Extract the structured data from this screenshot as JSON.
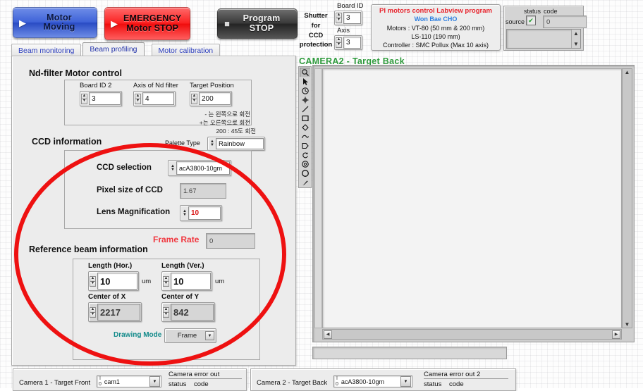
{
  "toolbar": {
    "motor_moving": "Motor Moving",
    "emergency_l1": "EMERGENCY",
    "emergency_l2": "Motor STOP",
    "program_stop": "Program STOP"
  },
  "tabs": [
    {
      "label": "Beam monitoring",
      "selected": false
    },
    {
      "label": "Beam profiling",
      "selected": true
    },
    {
      "label": "Motor calibration",
      "selected": false
    }
  ],
  "shutter": {
    "title_l1": "Shutter for",
    "title_l2": "CCD",
    "title_l3": "protection",
    "board_id_label": "Board ID",
    "board_id_value": "3",
    "axis_label": "Axis",
    "axis_value": "3"
  },
  "program_info": {
    "line1": "PI motors control Labview program",
    "line2": "Won Bae CHO",
    "line3": "Motors : VT-80 (50 mm & 200 mm)",
    "line4": "LS-110 (190 mm)",
    "line5": "Controller : SMC Pollux (Max 10 axis)"
  },
  "error_cluster_top": {
    "status_label": "status",
    "code_label": "code",
    "source_label": "source",
    "code_value": "0",
    "status_glyph": "check"
  },
  "nd_filter": {
    "section_title": "Nd-filter Motor control",
    "board_id_label": "Board ID 2",
    "board_id_value": "3",
    "axis_label": "Axis of Nd filter",
    "axis_value": "4",
    "target_label": "Target Position",
    "target_value": "200",
    "note1": "- 는 왼쪽으로 회전",
    "note2": "+는 오른쪽으로 회전",
    "note3": "200 : 45도 회전"
  },
  "ccd_info": {
    "section_title": "CCD information",
    "palette_label": "Palette Type",
    "palette_value": "Rainbow",
    "ccd_selection_label": "CCD selection",
    "ccd_selection_value": "acA3800-10gm",
    "pixel_size_label": "Pixel size of CCD",
    "pixel_size_value": "1.67",
    "lens_mag_label": "Lens Magnification",
    "lens_mag_value": "10",
    "frame_rate_label": "Frame Rate",
    "frame_rate_value": "0"
  },
  "ref_beam": {
    "section_title": "Reference beam information",
    "len_hor_label": "Length (Hor.)",
    "len_hor_value": "10",
    "len_hor_unit": "um",
    "len_ver_label": "Length (Ver.)",
    "len_ver_value": "10",
    "len_ver_unit": "um",
    "center_x_label": "Center of X",
    "center_x_value": "2217",
    "center_y_label": "Center of Y",
    "center_y_value": "842",
    "drawing_mode_label": "Drawing Mode",
    "drawing_mode_value": "Frame"
  },
  "camera_panel": {
    "title": "CAMERA2 - Target Back",
    "tools": [
      "zoom-icon",
      "cursor-icon",
      "pan-icon",
      "crosshair-icon",
      "line-icon",
      "rectangle-icon",
      "oval-icon",
      "freehand-icon",
      "polygon-icon",
      "rotate-icon",
      "annulus-icon",
      "circle-icon",
      "brush-icon"
    ]
  },
  "bottom": {
    "cam1_label": "Camera 1 - Target Front",
    "cam1_value": "cam1",
    "cam1_error_title": "Camera error out",
    "cam1_status_label": "status",
    "cam1_code_label": "code",
    "cam2_label": "Camera 2 - Target Back",
    "cam2_value": "acA3800-10gm",
    "cam2_error_title": "Camera error out 2",
    "cam2_status_label": "status",
    "cam2_code_label": "code"
  },
  "annotation": {
    "shape": "red-ellipse-highlight",
    "color": "#ee1111"
  },
  "colors": {
    "panel_bg": "#ececec",
    "accent_red": "#e8242d",
    "accent_blue": "#2d7fe0",
    "camera_title_green": "#2f9b3d",
    "tab_text_blue": "#2d3fbe",
    "frame_rate_red": "#f0373f",
    "drawing_mode_teal": "#128a8a"
  }
}
